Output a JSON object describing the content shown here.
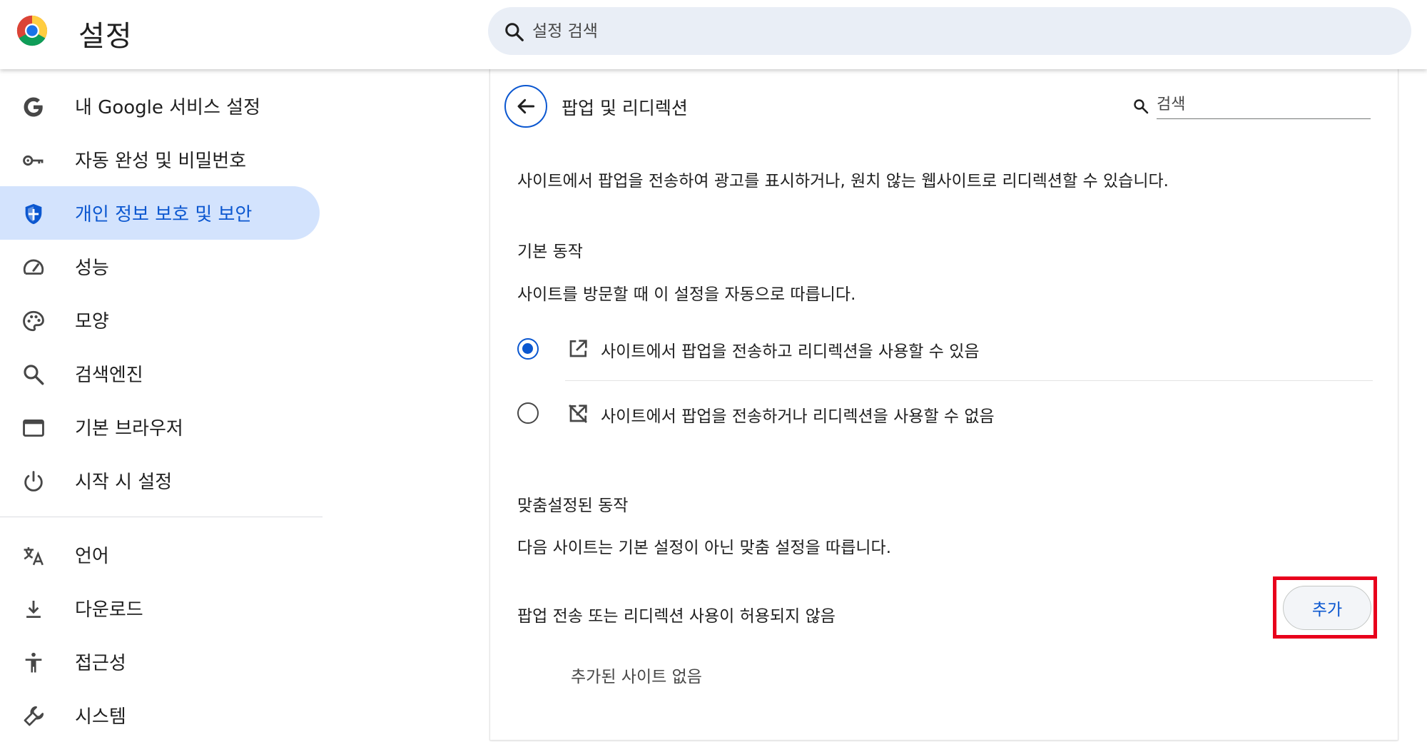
{
  "header": {
    "title": "설정",
    "search_placeholder": "설정 검색"
  },
  "sidebar": {
    "items": [
      {
        "label": "내 Google 서비스 설정",
        "icon": "google-g-icon"
      },
      {
        "label": "자동 완성 및 비밀번호",
        "icon": "key-icon"
      },
      {
        "label": "개인 정보 보호 및 보안",
        "icon": "shield-icon",
        "active": true
      },
      {
        "label": "성능",
        "icon": "speedometer-icon"
      },
      {
        "label": "모양",
        "icon": "palette-icon"
      },
      {
        "label": "검색엔진",
        "icon": "search-icon"
      },
      {
        "label": "기본 브라우저",
        "icon": "browser-window-icon"
      },
      {
        "label": "시작 시 설정",
        "icon": "power-icon"
      },
      {
        "label": "언어",
        "icon": "translate-icon"
      },
      {
        "label": "다운로드",
        "icon": "download-icon"
      },
      {
        "label": "접근성",
        "icon": "accessibility-icon"
      },
      {
        "label": "시스템",
        "icon": "wrench-icon"
      }
    ]
  },
  "main": {
    "title": "팝업 및 리디렉션",
    "search_placeholder": "검색",
    "description": "사이트에서 팝업을 전송하여 광고를 표시하거나, 원치 않는 웹사이트로 리디렉션할 수 있습니다.",
    "default_behavior": {
      "heading": "기본 동작",
      "subtext": "사이트를 방문할 때 이 설정을 자동으로 따릅니다.",
      "options": [
        {
          "label": "사이트에서 팝업을 전송하고 리디렉션을 사용할 수 있음",
          "checked": true,
          "icon": "open-in-new-icon"
        },
        {
          "label": "사이트에서 팝업을 전송하거나 리디렉션을 사용할 수 없음",
          "checked": false,
          "icon": "blocked-popup-icon"
        }
      ]
    },
    "custom_behavior": {
      "heading": "맞춤설정된 동작",
      "subtext": "다음 사이트는 기본 설정이 아닌 맞춤 설정을 따릅니다.",
      "blocked_label": "팝업 전송 또는 리디렉션 사용이 허용되지 않음",
      "add_label": "추가",
      "empty_label": "추가된 사이트 없음"
    }
  },
  "colors": {
    "accent": "#0b57d0",
    "active_nav_bg": "#d3e3fd",
    "search_bg": "#e9eef6",
    "highlight": "#e8001c"
  }
}
